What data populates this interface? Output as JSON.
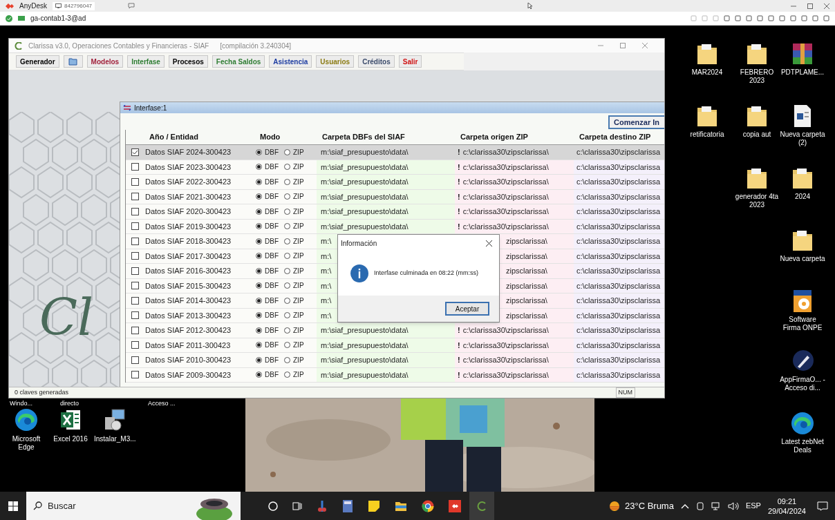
{
  "anydesk": {
    "app_name": "AnyDesk",
    "session_id": "842796047",
    "address": "ga-contab1-3@ad"
  },
  "app_window": {
    "title": "Clarissa v3.0, Operaciones Contables y Financieras - SIAF",
    "build": "[compilación 3.240304]",
    "toolbar": [
      {
        "kind": "text",
        "label": "Generador",
        "color": "#000000"
      },
      {
        "kind": "icon"
      },
      {
        "kind": "text",
        "label": "Modelos",
        "color": "#a0203a"
      },
      {
        "kind": "text",
        "label": "Interfase",
        "color": "#2e7d32"
      },
      {
        "kind": "text",
        "label": "Procesos",
        "color": "#000000"
      },
      {
        "kind": "text",
        "label": "Fecha Saldos",
        "color": "#2e7d32"
      },
      {
        "kind": "text",
        "label": "Asistencia",
        "color": "#1a3aa0"
      },
      {
        "kind": "text",
        "label": "Usuarios",
        "color": "#8a7a10"
      },
      {
        "kind": "text",
        "label": "Créditos",
        "color": "#3a4a6a"
      },
      {
        "kind": "text",
        "label": "Salir",
        "color": "#d01010"
      }
    ],
    "logo_text": "Cl",
    "child_window": {
      "title": "Interfase:1",
      "start_button": "Comenzar In",
      "columns": [
        "Año / Entidad",
        "Modo",
        "Carpeta DBFs del SIAF",
        "Carpeta origen ZIP",
        "Carpeta destino ZIP"
      ],
      "rows": [
        {
          "checked": true,
          "selected": true,
          "name": "Datos SIAF 2024-300423",
          "modes": [
            {
              "label": "DBF",
              "selected": true
            },
            {
              "label": "ZIP",
              "selected": false
            }
          ],
          "dbf": "m:\\siaf_presupuesto\\data\\",
          "flag": "!",
          "origin": "c:\\clarissa30\\zipsclarissa\\",
          "destination": "c:\\clarissa30\\zipsclarissa"
        },
        {
          "checked": false,
          "selected": false,
          "name": "Datos SIAF 2023-300423",
          "modes": [
            {
              "label": "DBF",
              "selected": true
            },
            {
              "label": "ZIP",
              "selected": false
            }
          ],
          "dbf": "m:\\siaf_presupuesto\\data\\",
          "flag": "!",
          "origin": "c:\\clarissa30\\zipsclarissa\\",
          "destination": "c:\\clarissa30\\zipsclarissa"
        },
        {
          "checked": false,
          "selected": false,
          "name": "Datos SIAF 2022-300423",
          "modes": [
            {
              "label": "DBF",
              "selected": true
            },
            {
              "label": "ZIP",
              "selected": false
            }
          ],
          "dbf": "m:\\siaf_presupuesto\\data\\",
          "flag": "!",
          "origin": "c:\\clarissa30\\zipsclarissa\\",
          "destination": "c:\\clarissa30\\zipsclarissa"
        },
        {
          "checked": false,
          "selected": false,
          "name": "Datos SIAF 2021-300423",
          "modes": [
            {
              "label": "DBF",
              "selected": true
            },
            {
              "label": "ZIP",
              "selected": false
            }
          ],
          "dbf": "m:\\siaf_presupuesto\\data\\",
          "flag": "!",
          "origin": "c:\\clarissa30\\zipsclarissa\\",
          "destination": "c:\\clarissa30\\zipsclarissa"
        },
        {
          "checked": false,
          "selected": false,
          "name": "Datos SIAF 2020-300423",
          "modes": [
            {
              "label": "DBF",
              "selected": true
            },
            {
              "label": "ZIP",
              "selected": false
            }
          ],
          "dbf": "m:\\siaf_presupuesto\\data\\",
          "flag": "!",
          "origin": "c:\\clarissa30\\zipsclarissa\\",
          "destination": "c:\\clarissa30\\zipsclarissa"
        },
        {
          "checked": false,
          "selected": false,
          "name": "Datos SIAF 2019-300423",
          "modes": [
            {
              "label": "DBF",
              "selected": true
            },
            {
              "label": "ZIP",
              "selected": false
            }
          ],
          "dbf": "m:\\siaf_presupuesto\\data\\",
          "flag": "!",
          "origin": "c:\\clarissa30\\zipsclarissa\\",
          "destination": "c:\\clarissa30\\zipsclarissa"
        },
        {
          "checked": false,
          "selected": false,
          "name": "Datos SIAF 2018-300423",
          "modes": [
            {
              "label": "DBF",
              "selected": true
            },
            {
              "label": "ZIP",
              "selected": false
            }
          ],
          "dbf": "m:\\",
          "origin": "zipsclarissa\\",
          "destination": "c:\\clarissa30\\zipsclarissa"
        },
        {
          "checked": false,
          "selected": false,
          "name": "Datos SIAF 2017-300423",
          "modes": [
            {
              "label": "DBF",
              "selected": true
            },
            {
              "label": "ZIP",
              "selected": false
            }
          ],
          "dbf": "m:\\",
          "origin": "zipsclarissa\\",
          "destination": "c:\\clarissa30\\zipsclarissa"
        },
        {
          "checked": false,
          "selected": false,
          "name": "Datos SIAF 2016-300423",
          "modes": [
            {
              "label": "DBF",
              "selected": true
            },
            {
              "label": "ZIP",
              "selected": false
            }
          ],
          "dbf": "m:\\",
          "origin": "zipsclarissa\\",
          "destination": "c:\\clarissa30\\zipsclarissa"
        },
        {
          "checked": false,
          "selected": false,
          "name": "Datos SIAF 2015-300423",
          "modes": [
            {
              "label": "DBF",
              "selected": true
            },
            {
              "label": "ZIP",
              "selected": false
            }
          ],
          "dbf": "m:\\",
          "origin": "zipsclarissa\\",
          "destination": "c:\\clarissa30\\zipsclarissa"
        },
        {
          "checked": false,
          "selected": false,
          "name": "Datos SIAF 2014-300423",
          "modes": [
            {
              "label": "DBF",
              "selected": true
            },
            {
              "label": "ZIP",
              "selected": false
            }
          ],
          "dbf": "m:\\",
          "origin": "zipsclarissa\\",
          "destination": "c:\\clarissa30\\zipsclarissa"
        },
        {
          "checked": false,
          "selected": false,
          "name": "Datos SIAF 2013-300423",
          "modes": [
            {
              "label": "DBF",
              "selected": true
            },
            {
              "label": "ZIP",
              "selected": false
            }
          ],
          "dbf": "m:\\",
          "origin": "zipsclarissa\\",
          "destination": "c:\\clarissa30\\zipsclarissa"
        },
        {
          "checked": false,
          "selected": false,
          "name": "Datos SIAF 2012-300423",
          "modes": [
            {
              "label": "DBF",
              "selected": true
            },
            {
              "label": "ZIP",
              "selected": false
            }
          ],
          "dbf": "m:\\siaf_presupuesto\\data\\",
          "flag": "!",
          "origin": "c:\\clarissa30\\zipsclarissa\\",
          "destination": "c:\\clarissa30\\zipsclarissa"
        },
        {
          "checked": false,
          "selected": false,
          "name": "Datos SIAF 2011-300423",
          "modes": [
            {
              "label": "DBF",
              "selected": true
            },
            {
              "label": "ZIP",
              "selected": false
            }
          ],
          "dbf": "m:\\siaf_presupuesto\\data\\",
          "flag": "!",
          "origin": "c:\\clarissa30\\zipsclarissa\\",
          "destination": "c:\\clarissa30\\zipsclarissa"
        },
        {
          "checked": false,
          "selected": false,
          "name": "Datos SIAF 2010-300423",
          "modes": [
            {
              "label": "DBF",
              "selected": true
            },
            {
              "label": "ZIP",
              "selected": false
            }
          ],
          "dbf": "m:\\siaf_presupuesto\\data\\",
          "flag": "!",
          "origin": "c:\\clarissa30\\zipsclarissa\\",
          "destination": "c:\\clarissa30\\zipsclarissa"
        },
        {
          "checked": false,
          "selected": false,
          "name": "Datos SIAF 2009-300423",
          "modes": [
            {
              "label": "DBF",
              "selected": true
            },
            {
              "label": "ZIP",
              "selected": false
            }
          ],
          "dbf": "m:\\siaf_presupuesto\\data\\",
          "flag": "!",
          "origin": "c:\\clarissa30\\zipsclarissa\\",
          "destination": "c:\\clarissa30\\zipsclarissa"
        }
      ]
    },
    "dialog": {
      "title": "Información",
      "message": "Interfase culminada en 08:22 (mm:ss)",
      "button": "Aceptar"
    },
    "status_bar": {
      "text": "0 claves generadas",
      "indicator": "NUM"
    }
  },
  "desktop": {
    "hidden_labels": [
      "Windo...",
      "directo",
      "Acceso ..."
    ],
    "left_icons": [
      {
        "kind": "edge",
        "label": "Microsoft Edge"
      },
      {
        "kind": "excel",
        "label": "Excel 2016"
      },
      {
        "kind": "installer",
        "label": "Instalar_M3..."
      }
    ],
    "right_icons": [
      {
        "kind": "folder",
        "label": "MAR2024"
      },
      {
        "kind": "folder",
        "label": "FEBRERO 2023"
      },
      {
        "kind": "archive",
        "label": "PDTPLAME..."
      },
      {
        "kind": "folder",
        "label": "retificatoria"
      },
      {
        "kind": "folder",
        "label": "copia aut"
      },
      {
        "kind": "document",
        "label": "Nueva carpeta (2)"
      },
      {
        "kind": "folder",
        "label": "generador 4ta 2023"
      },
      {
        "kind": "folder",
        "label": "2024"
      },
      {
        "kind": "folder",
        "label": "Nueva carpeta"
      },
      {
        "kind": "disc",
        "label": "Software Firma ONPE"
      },
      {
        "kind": "pen",
        "label": "AppFirmaO... - Acceso di..."
      },
      {
        "kind": "edge",
        "label": "Latest zebNet Deals"
      }
    ]
  },
  "taskbar": {
    "search_placeholder": "Buscar",
    "weather": "23°C Bruma",
    "language": "ESP",
    "time": "09:21",
    "date": "29/04/2024"
  }
}
